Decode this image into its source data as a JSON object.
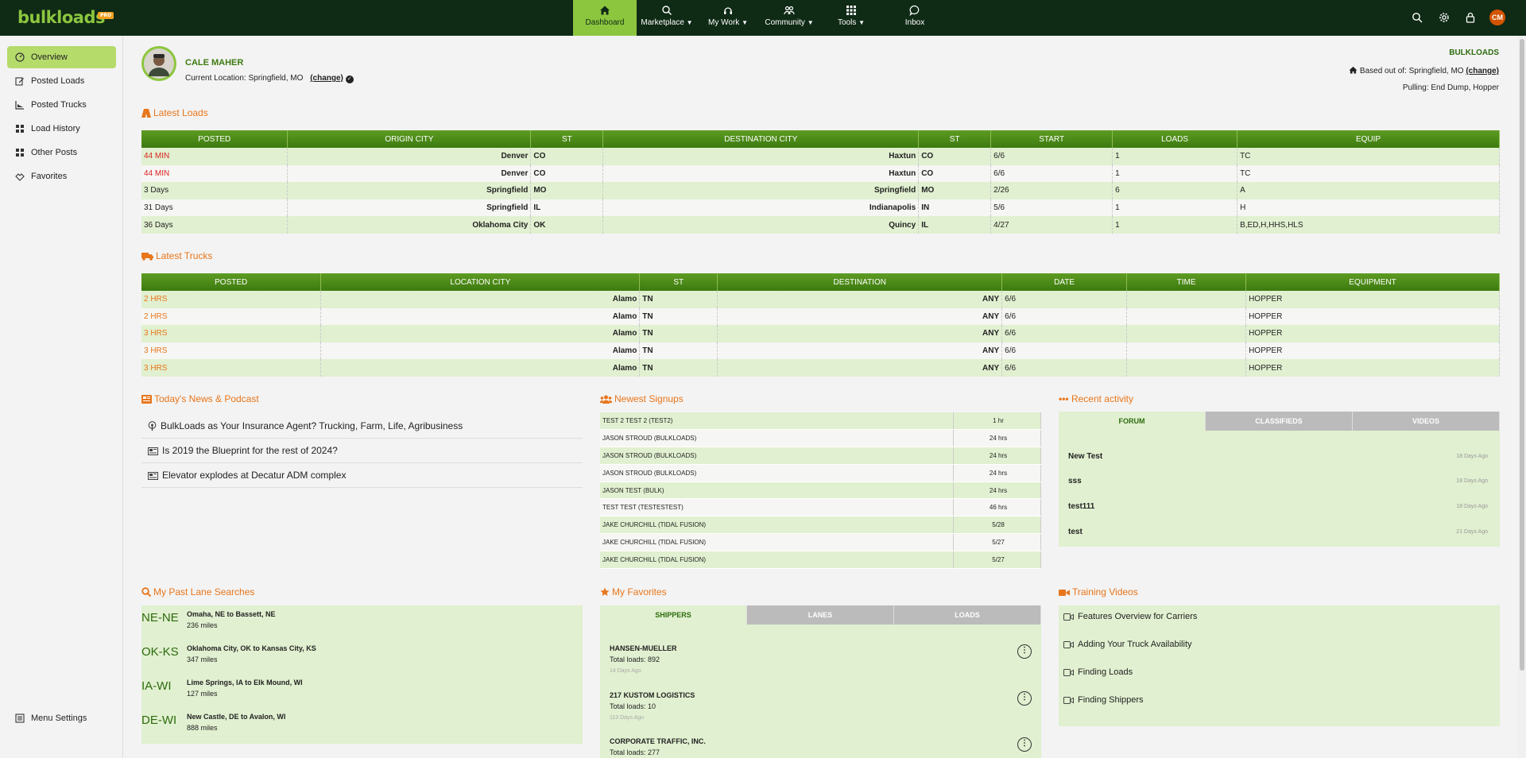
{
  "brand": {
    "logo": "bulkloads",
    "badge": "PRO"
  },
  "nav": [
    {
      "label": "Dashboard",
      "icon": "home-icon"
    },
    {
      "label": "Marketplace",
      "icon": "search-icon"
    },
    {
      "label": "My Work",
      "icon": "headset-icon"
    },
    {
      "label": "Community",
      "icon": "people-icon"
    },
    {
      "label": "Tools",
      "icon": "grid-icon"
    },
    {
      "label": "Inbox",
      "icon": "chat-icon"
    }
  ],
  "user_initials": "CM",
  "sidebar": {
    "items": [
      {
        "label": "Overview",
        "icon": "dashboard-icon"
      },
      {
        "label": "Posted Loads",
        "icon": "edit-icon"
      },
      {
        "label": "Posted Trucks",
        "icon": "chart-icon"
      },
      {
        "label": "Load History",
        "icon": "list-icon"
      },
      {
        "label": "Other Posts",
        "icon": "list-icon"
      },
      {
        "label": "Favorites",
        "icon": "handshake-icon"
      }
    ],
    "menu_settings": "Menu Settings"
  },
  "profile": {
    "name": "CALE MAHER",
    "location_label": "Current Location: Springfield, MO",
    "change": "(change)"
  },
  "company": {
    "name": "BULKLOADS",
    "based_label": "Based out of: Springfield, MO",
    "change": "(change)",
    "pulling": "Pulling: End Dump, Hopper"
  },
  "latest_loads": {
    "title": "Latest Loads",
    "headers": [
      "POSTED",
      "ORIGIN CITY",
      "ST",
      "DESTINATION CITY",
      "ST",
      "START",
      "LOADS",
      "EQUIP"
    ],
    "rows": [
      [
        "44 MIN",
        "Denver",
        "CO",
        "Haxtun",
        "CO",
        "6/6",
        "1",
        "TC"
      ],
      [
        "44 MIN",
        "Denver",
        "CO",
        "Haxtun",
        "CO",
        "6/6",
        "1",
        "TC"
      ],
      [
        "3 Days",
        "Springfield",
        "MO",
        "Springfield",
        "MO",
        "2/26",
        "6",
        "A"
      ],
      [
        "31 Days",
        "Springfield",
        "IL",
        "Indianapolis",
        "IN",
        "5/6",
        "1",
        "H"
      ],
      [
        "36 Days",
        "Oklahoma City",
        "OK",
        "Quincy",
        "IL",
        "4/27",
        "1",
        "B,ED,H,HHS,HLS"
      ]
    ]
  },
  "latest_trucks": {
    "title": "Latest Trucks",
    "headers": [
      "POSTED",
      "LOCATION CITY",
      "ST",
      "DESTINATION",
      "DATE",
      "TIME",
      "EQUIPMENT"
    ],
    "rows": [
      [
        "2 HRS",
        "Alamo",
        "TN",
        "ANY",
        "6/6",
        "",
        "HOPPER"
      ],
      [
        "2 HRS",
        "Alamo",
        "TN",
        "ANY",
        "6/6",
        "",
        "HOPPER"
      ],
      [
        "3 HRS",
        "Alamo",
        "TN",
        "ANY",
        "6/6",
        "",
        "HOPPER"
      ],
      [
        "3 HRS",
        "Alamo",
        "TN",
        "ANY",
        "6/6",
        "",
        "HOPPER"
      ],
      [
        "3 HRS",
        "Alamo",
        "TN",
        "ANY",
        "6/6",
        "",
        "HOPPER"
      ]
    ]
  },
  "news": {
    "title": "Today's News & Podcast",
    "items": [
      {
        "text": "BulkLoads as Your Insurance Agent? Trucking, Farm, Life, Agribusiness",
        "icon": "podcast-icon"
      },
      {
        "text": "Is 2019 the Blueprint for the rest of 2024?",
        "icon": "newspaper-icon"
      },
      {
        "text": "Elevator explodes at Decatur ADM complex",
        "icon": "newspaper-icon"
      }
    ]
  },
  "signups": {
    "title": "Newest Signups",
    "rows": [
      [
        "TEST 2 TEST 2 (TEST2)",
        "1 hr"
      ],
      [
        "JASON STROUD (BULKLOADS)",
        "24 hrs"
      ],
      [
        "JASON STROUD (BULKLOADS)",
        "24 hrs"
      ],
      [
        "JASON STROUD (BULKLOADS)",
        "24 hrs"
      ],
      [
        "JASON TEST (BULK)",
        "24 hrs"
      ],
      [
        "TEST TEST (TESTESTEST)",
        "46 hrs"
      ],
      [
        "JAKE CHURCHILL (TIDAL FUSION)",
        "5/28"
      ],
      [
        "JAKE CHURCHILL (TIDAL FUSION)",
        "5/27"
      ],
      [
        "JAKE CHURCHILL (TIDAL FUSION)",
        "5/27"
      ]
    ]
  },
  "activity": {
    "title": "Recent activity",
    "tabs": [
      "FORUM",
      "CLASSIFIEDS",
      "VIDEOS"
    ],
    "items": [
      {
        "title": "New Test",
        "ago": "18 Days Ago"
      },
      {
        "title": "sss",
        "ago": "18 Days Ago"
      },
      {
        "title": "test111",
        "ago": "18 Days Ago"
      },
      {
        "title": "test",
        "ago": "21 Days Ago"
      }
    ]
  },
  "lanes": {
    "title": "My Past Lane Searches",
    "items": [
      {
        "code": "NE-NE",
        "desc": "Omaha, NE to Bassett, NE",
        "miles": "236 miles"
      },
      {
        "code": "OK-KS",
        "desc": "Oklahoma City, OK to Kansas City, KS",
        "miles": "347 miles"
      },
      {
        "code": "IA-WI",
        "desc": "Lime Springs, IA to Elk Mound, WI",
        "miles": "127 miles"
      },
      {
        "code": "DE-WI",
        "desc": "New Castle, DE to Avalon, WI",
        "miles": "888 miles"
      }
    ]
  },
  "favorites": {
    "title": "My Favorites",
    "tabs": [
      "SHIPPERS",
      "LANES",
      "LOADS"
    ],
    "items": [
      {
        "name": "HANSEN-MUELLER",
        "loads": "Total loads: 892",
        "ago": "14 Days Ago"
      },
      {
        "name": "217 KUSTOM LOGISTICS",
        "loads": "Total loads: 10",
        "ago": "113 Days Ago"
      },
      {
        "name": "CORPORATE TRAFFIC, INC.",
        "loads": "Total loads: 277",
        "ago": ""
      }
    ]
  },
  "training": {
    "title": "Training Videos",
    "items": [
      "Features Overview for Carriers",
      "Adding Your Truck Availability",
      "Finding Loads",
      "Finding Shippers"
    ]
  }
}
